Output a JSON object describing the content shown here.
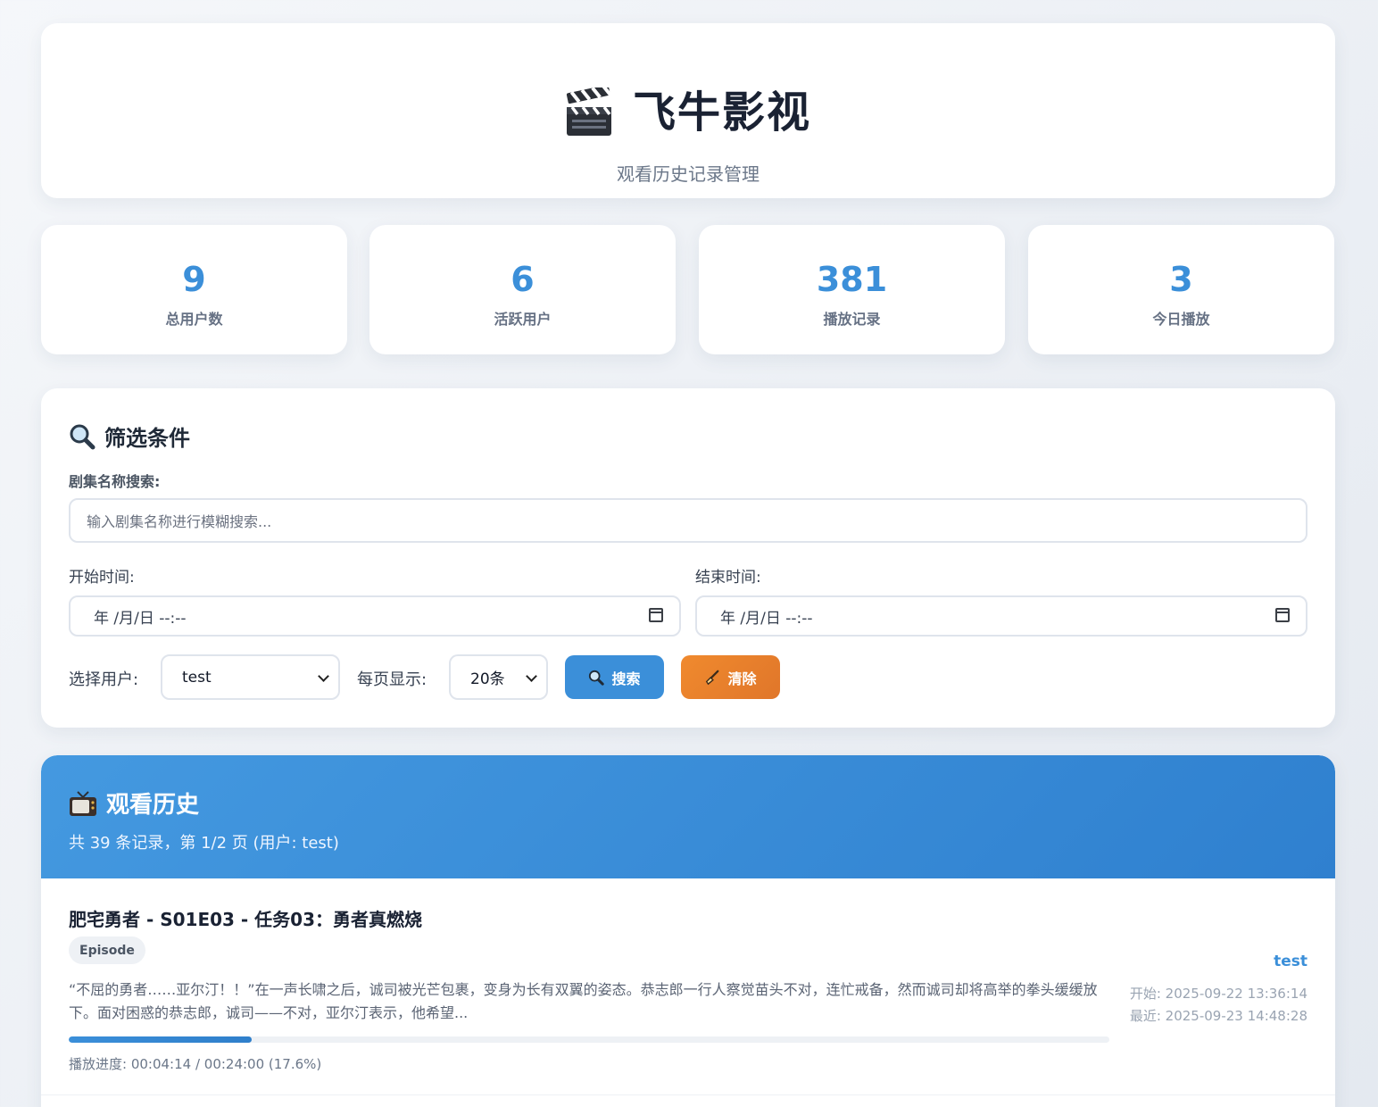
{
  "header": {
    "title": "飞牛影视",
    "subtitle": "观看历史记录管理",
    "icon": "clapperboard-icon"
  },
  "stats": [
    {
      "value": "9",
      "label": "总用户数"
    },
    {
      "value": "6",
      "label": "活跃用户"
    },
    {
      "value": "381",
      "label": "播放记录"
    },
    {
      "value": "3",
      "label": "今日播放"
    }
  ],
  "filters": {
    "title": "筛选条件",
    "search_label": "剧集名称搜索:",
    "search_placeholder": "输入剧集名称进行模糊搜索...",
    "start_label": "开始时间:",
    "end_label": "结束时间:",
    "date_placeholder": "年 /月/日 --:--",
    "user_label": "选择用户:",
    "user_value": "test",
    "page_size_label": "每页显示:",
    "page_size_value": "20条",
    "search_button": "搜索",
    "clear_button": "清除"
  },
  "history": {
    "title": "观看历史",
    "summary": "共 39 条记录，第 1/2 页 (用户: test)",
    "items": [
      {
        "title": "肥宅勇者 - S01E03 - 任务03：勇者真燃烧",
        "type": "Episode",
        "description": "“不屈的勇者……亚尔汀！！”在一声长啸之后，诚司被光芒包裹，变身为长有双翼的姿态。恭志郎一行人察觉苗头不对，连忙戒备，然而诚司却将高举的拳头缓缓放下。面对困惑的恭志郎，诚司——不对，亚尔汀表示，他希望...",
        "progress_fraction": 0.176,
        "progress_text": "播放进度: 00:04:14 / 00:24:00 (17.6%)",
        "user": "test",
        "start_time": "开始: 2025-09-22 13:36:14",
        "last_time": "最近: 2025-09-23 14:48:28"
      }
    ]
  },
  "colors": {
    "accent": "#3b8fd9",
    "clear_button": "#ec8230",
    "header_gradient_start": "#4499e0",
    "header_gradient_end": "#2f80cf"
  }
}
